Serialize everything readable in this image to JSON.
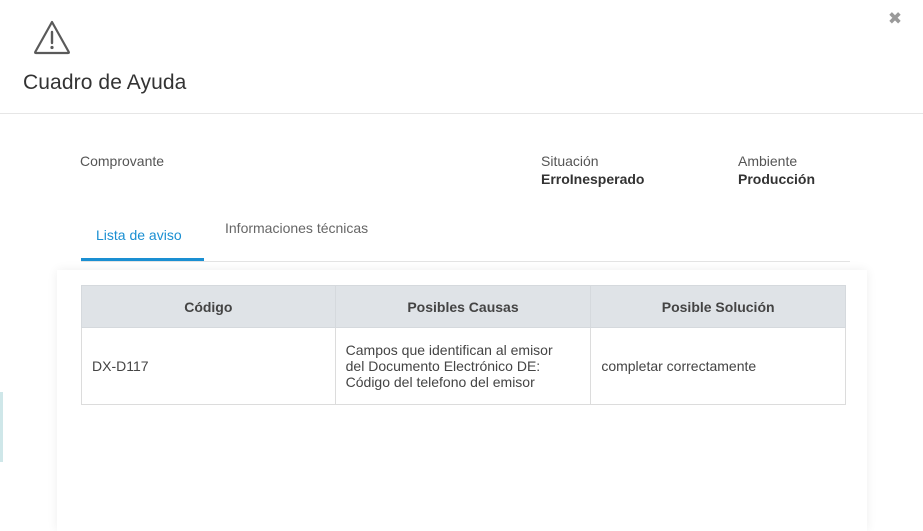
{
  "header": {
    "title": "Cuadro de Ayuda",
    "warning_icon": "warning-triangle-icon",
    "close_icon": "close-icon",
    "close_glyph": "✖"
  },
  "info": {
    "comprobante_label": "Comprovante",
    "situacion_label": "Situación",
    "situacion_value": "ErroInesperado",
    "ambiente_label": "Ambiente",
    "ambiente_value": "Producción"
  },
  "tabs": [
    {
      "label": "Lista de aviso",
      "active": true
    },
    {
      "label": "Informaciones técnicas",
      "active": false
    }
  ],
  "table": {
    "headers": [
      "Código",
      "Posibles Causas",
      "Posible Solución"
    ],
    "rows": [
      {
        "codigo": "DX-D117",
        "causas": [
          "Campos que identifican al emisor",
          "del Documento Electrónico DE:",
          "Código del telefono del emisor"
        ],
        "solucion": "completar correctamente"
      }
    ]
  },
  "colors": {
    "accent": "#1a8fd2",
    "header_bg": "#dfe3e7",
    "divider": "#e6e6e6"
  }
}
